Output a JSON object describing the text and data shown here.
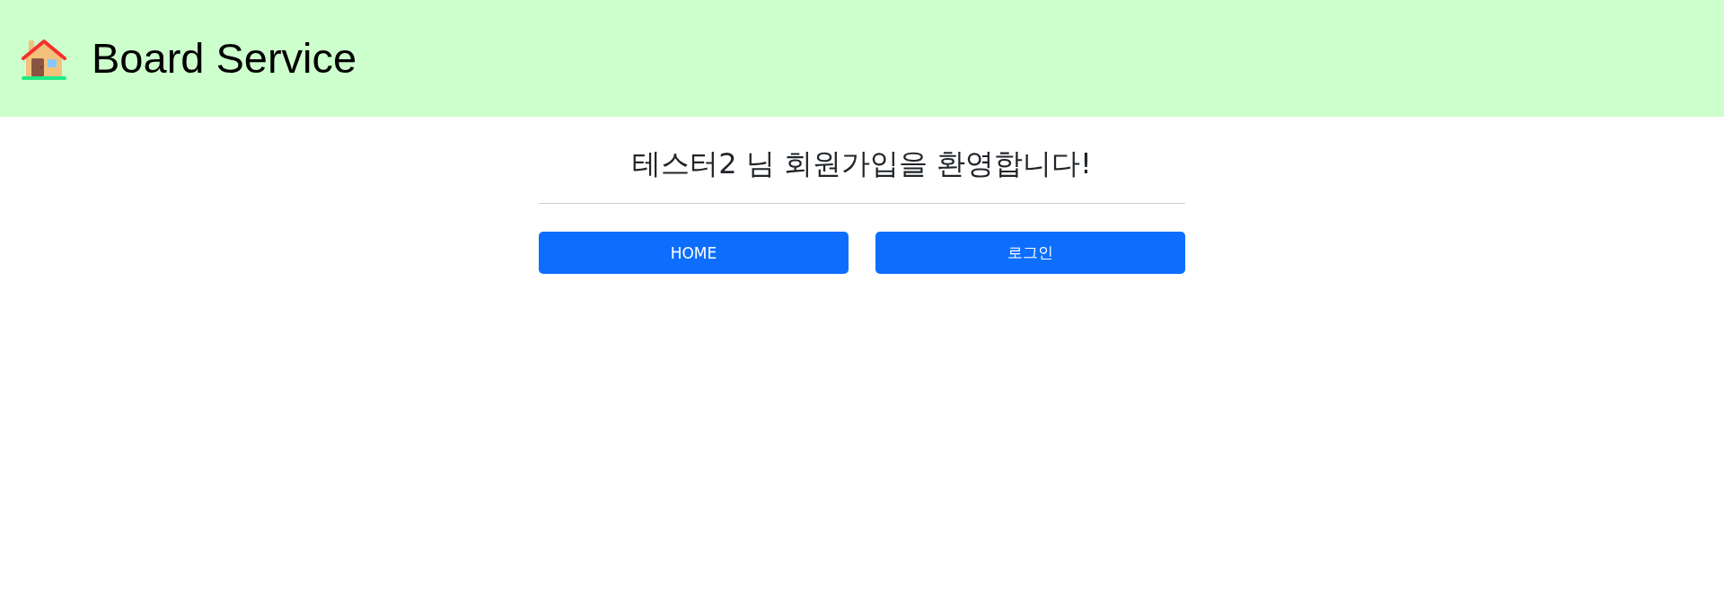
{
  "header": {
    "title": "Board Service"
  },
  "welcome": {
    "message": "테스터2 님 회원가입을 환영합니다!"
  },
  "buttons": [
    {
      "label": "HOME"
    },
    {
      "label": "로그인"
    }
  ]
}
